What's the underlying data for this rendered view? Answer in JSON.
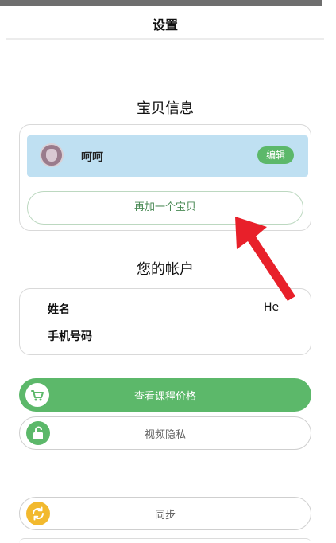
{
  "header": {
    "title": "设置"
  },
  "baby_section": {
    "title": "宝贝信息",
    "baby": {
      "name": "呵呵",
      "edit_label": "编辑"
    },
    "add_baby_label": "再加一个宝贝"
  },
  "account_section": {
    "title": "您的帐户",
    "name_label": "姓名",
    "name_value": "He",
    "phone_label": "手机号码"
  },
  "actions": {
    "course_price": {
      "label": "查看课程价格",
      "icon": "cart-icon"
    },
    "video_privacy": {
      "label": "视频隐私",
      "icon": "unlock-icon"
    },
    "sync": {
      "label": "同步",
      "icon": "refresh-icon"
    }
  },
  "colors": {
    "accent_green": "#5cb86a",
    "baby_row_bg": "#bfe0f2",
    "sync_yellow": "#f2b92e",
    "arrow_red": "#e8202a"
  }
}
